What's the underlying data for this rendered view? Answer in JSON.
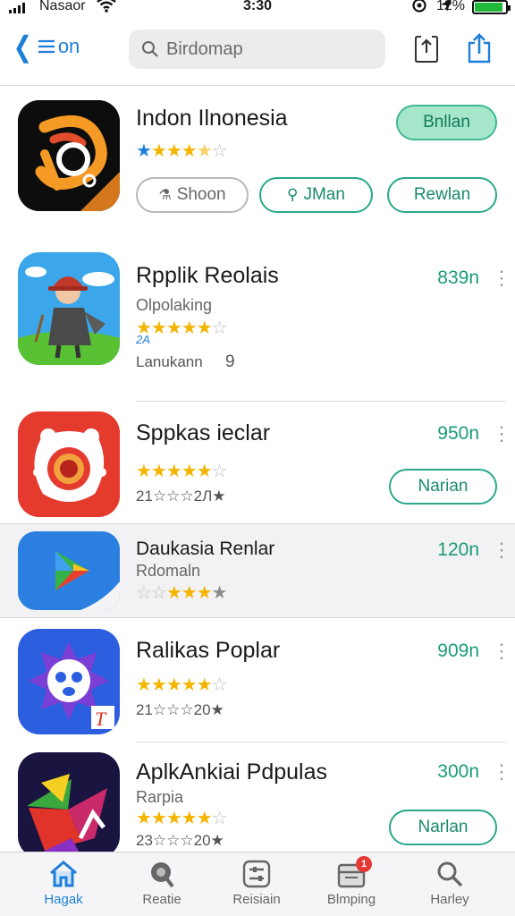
{
  "status_bar": {
    "carrier": "Nasaor",
    "time": "3:30",
    "battery_pct": "12%",
    "battery_level": 0.9
  },
  "nav": {
    "back_label": "on",
    "search_text": "Birdomap"
  },
  "apps": [
    {
      "title": "Indon Ilnonesia",
      "stars": "★★★★☆☆",
      "action_label": "Bnllan",
      "buttons": [
        "Shoon",
        "JMan",
        "Rewlan"
      ]
    },
    {
      "title": "Rpplik Reolais",
      "subtitle": "Olpolaking",
      "stars": "★★★★★☆",
      "stars_note": "2A",
      "rating_count": "Lanukann",
      "rating_num": "9",
      "price": "839n"
    },
    {
      "title": "Sppkas ieclar",
      "stars": "★★★★★☆",
      "rating_count": "21☆☆☆2Л★",
      "price": "950n",
      "action_label": "Narian"
    },
    {
      "title": "Daukasia Renlar",
      "subtitle": "Rdomaln",
      "stars": "☆☆★★★★",
      "price": "120n"
    },
    {
      "title": "Ralikas Poplar",
      "stars": "★★★★★☆",
      "rating_count": "21☆☆☆20★",
      "price": "909n"
    },
    {
      "title": "AplkAnkiai Pdpulas",
      "subtitle": "Rarpia",
      "stars": "★★★★★☆",
      "rating_count": "23☆☆☆20★",
      "price": "300n",
      "action_label": "Narlan"
    }
  ],
  "tabs": [
    {
      "label": "Hagak",
      "icon": "home-icon",
      "active": true
    },
    {
      "label": "Reatie",
      "icon": "rocket-icon",
      "active": false
    },
    {
      "label": "Reisiain",
      "icon": "sliders-icon",
      "active": false
    },
    {
      "label": "Blmping",
      "icon": "updates-icon",
      "active": false,
      "badge": "1"
    },
    {
      "label": "Harley",
      "icon": "search-icon",
      "active": false
    }
  ],
  "colors": {
    "accent_blue": "#1e7fd9",
    "accent_green": "#1a9b7a",
    "star_gold": "#f4b400"
  }
}
